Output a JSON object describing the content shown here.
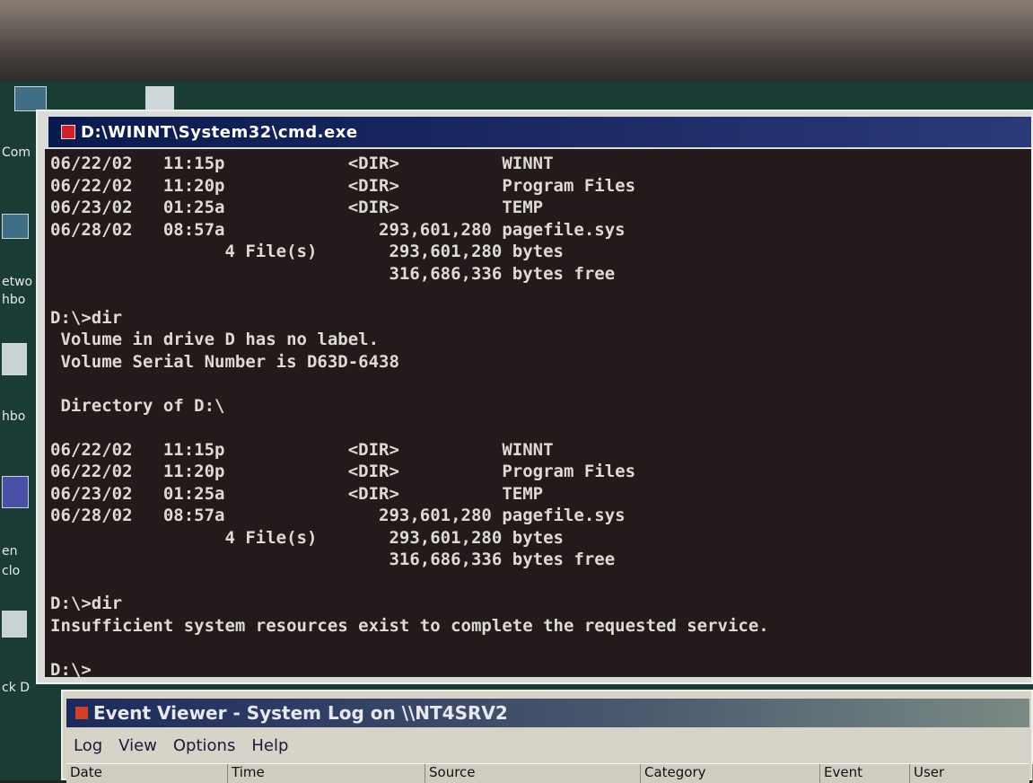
{
  "desktop": {
    "icon_labels": [
      "Com",
      "etwo",
      "hbo",
      "hbo",
      "en",
      "clo",
      "ck D"
    ]
  },
  "cmd_window": {
    "title": "D:\\WINNT\\System32\\cmd.exe",
    "console_lines": [
      "06/22/02   11:15p            <DIR>          WINNT",
      "06/22/02   11:20p            <DIR>          Program Files",
      "06/23/02   01:25a            <DIR>          TEMP",
      "06/28/02   08:57a               293,601,280 pagefile.sys",
      "                 4 File(s)       293,601,280 bytes",
      "                                 316,686,336 bytes free",
      "",
      "D:\\>dir",
      " Volume in drive D has no label.",
      " Volume Serial Number is D63D-6438",
      "",
      " Directory of D:\\",
      "",
      "06/22/02   11:15p            <DIR>          WINNT",
      "06/22/02   11:20p            <DIR>          Program Files",
      "06/23/02   01:25a            <DIR>          TEMP",
      "06/28/02   08:57a               293,601,280 pagefile.sys",
      "                 4 File(s)       293,601,280 bytes",
      "                                 316,686,336 bytes free",
      "",
      "D:\\>dir",
      "Insufficient system resources exist to complete the requested service.",
      "",
      "D:\\>"
    ]
  },
  "event_viewer": {
    "title": "Event Viewer - System Log on \\\\NT4SRV2",
    "menu": [
      "Log",
      "View",
      "Options",
      "Help"
    ],
    "columns": [
      "Date",
      "Time",
      "Source",
      "Category",
      "Event",
      "User"
    ]
  }
}
